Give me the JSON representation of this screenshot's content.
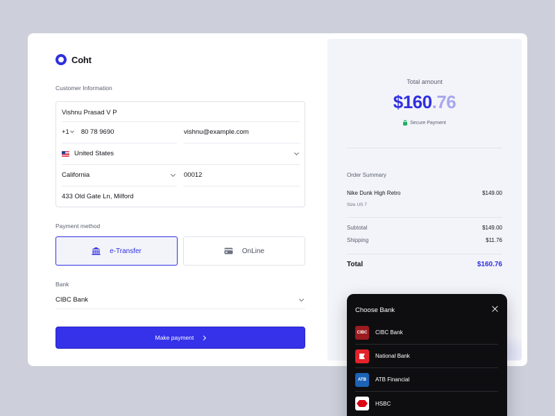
{
  "brand": {
    "name": "Coht"
  },
  "customer": {
    "section_label": "Customer Information",
    "name": "Vishnu Prasad V P",
    "phone_prefix": "+1",
    "phone": "80 78 9690",
    "email": "vishnu@example.com",
    "country": "United States",
    "state": "California",
    "zip": "00012",
    "address": "433 Old Gate Ln, Milford"
  },
  "payment": {
    "section_label": "Payment method",
    "options": [
      {
        "label": "e-Transfer",
        "icon": "bank-icon",
        "selected": true
      },
      {
        "label": "OnLine",
        "icon": "card-icon",
        "selected": false
      }
    ]
  },
  "bank": {
    "section_label": "Bank",
    "selected": "CIBC Bank"
  },
  "pay_button": {
    "label": "Make payment"
  },
  "summary": {
    "total_label": "Total amount",
    "total_main": "$160",
    "total_cents": ".76",
    "secure_label": "Secure Payment",
    "order_label": "Order Summary",
    "item_name": "Nike Dunk High Retro",
    "item_price": "$149.00",
    "item_size": "Size US 7",
    "subtotal_label": "Subtotal",
    "subtotal_value": "$149.00",
    "shipping_label": "Shipping",
    "shipping_value": "$11.76",
    "total_row_label": "Total",
    "total_row_value": "$160.76"
  },
  "bank_popup": {
    "title": "Choose Bank",
    "banks": [
      {
        "name": "CIBC Bank",
        "logo_text": "CIBC"
      },
      {
        "name": "National Bank",
        "logo_text": ""
      },
      {
        "name": "ATB Financial",
        "logo_text": "ATB"
      },
      {
        "name": "HSBC",
        "logo_text": ""
      }
    ]
  },
  "colors": {
    "accent": "#2f2fe0",
    "background": "#cdd0da",
    "popup_bg": "#0e0e11"
  }
}
